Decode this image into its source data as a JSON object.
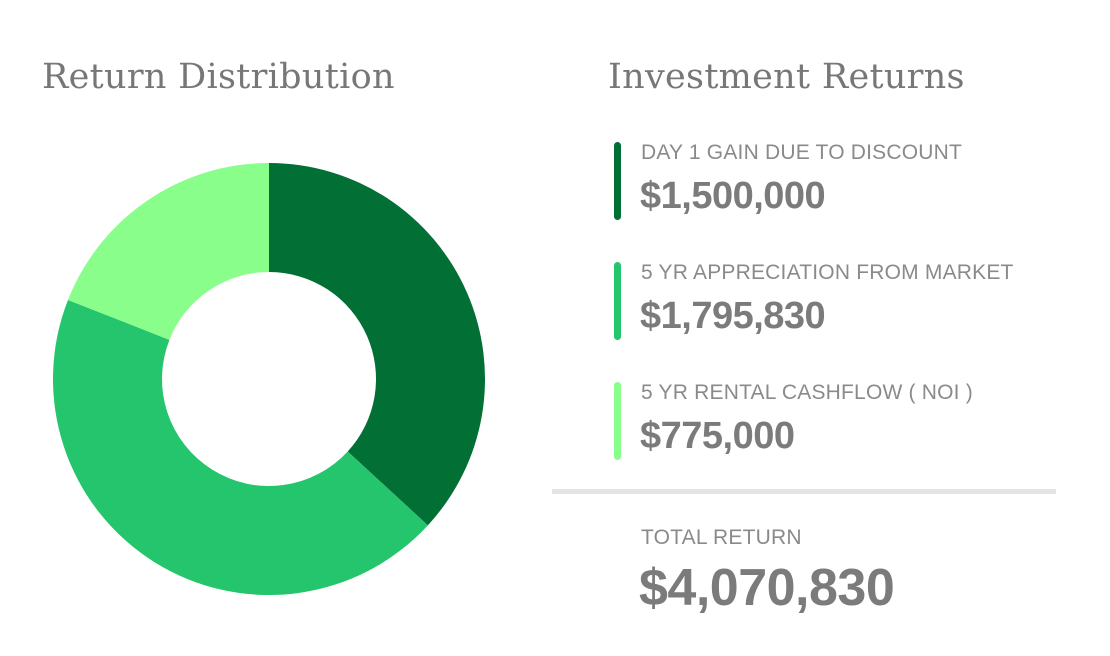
{
  "chart_heading": "Return Distribution",
  "returns_heading": "Investment Returns",
  "items": [
    {
      "label": "DAY 1 GAIN DUE TO DISCOUNT",
      "value": "$1,500,000",
      "color": "#026f34"
    },
    {
      "label": "5 YR APPRECIATION FROM MARKET",
      "value": "$1,795,830",
      "color": "#24c56c"
    },
    {
      "label": "5 YR RENTAL CASHFLOW ( NOI )",
      "value": "$775,000",
      "color": "#8afe8a"
    }
  ],
  "total": {
    "label": "TOTAL RETURN",
    "value": "$4,070,830"
  },
  "chart_data": {
    "type": "pie",
    "donut": true,
    "title": "Return Distribution",
    "categories": [
      "DAY 1 GAIN DUE TO DISCOUNT",
      "5 YR APPRECIATION FROM MARKET",
      "5 YR RENTAL CASHFLOW ( NOI )"
    ],
    "values": [
      1500000,
      1795830,
      775000
    ],
    "colors": [
      "#026f34",
      "#24c56c",
      "#8afe8a"
    ],
    "legend": "none"
  }
}
